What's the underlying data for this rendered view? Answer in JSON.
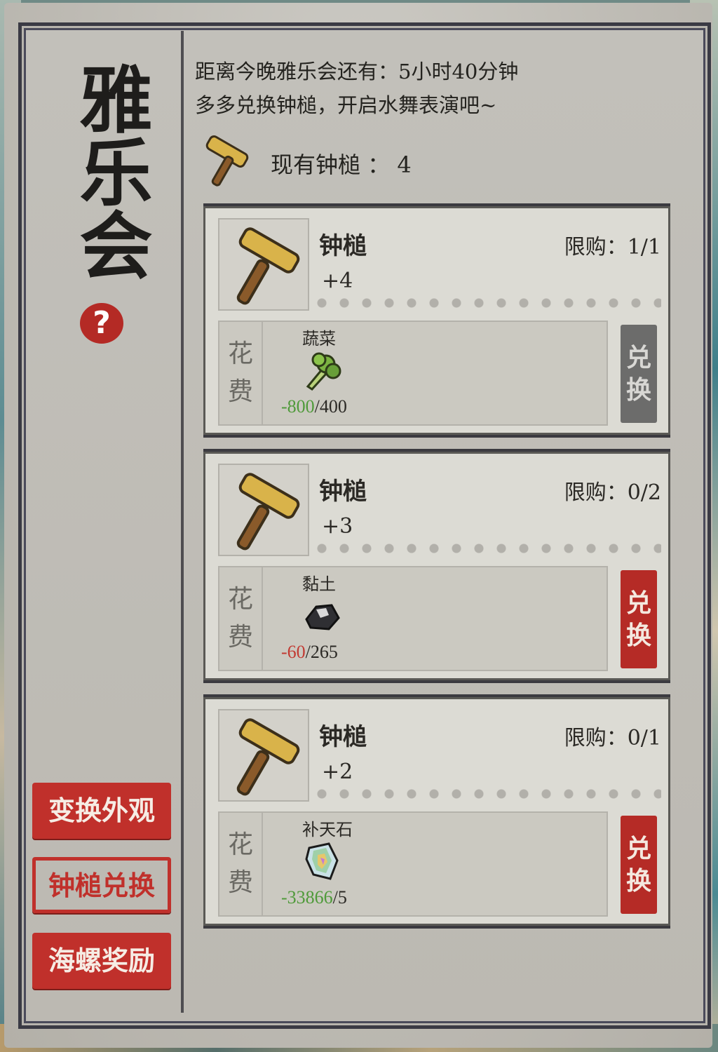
{
  "title": "雅乐会",
  "help_label": "?",
  "side_buttons": [
    {
      "label": "变换外观",
      "active": false
    },
    {
      "label": "钟槌兑换",
      "active": true
    },
    {
      "label": "海螺奖励",
      "active": false
    }
  ],
  "info": {
    "countdown": "距离今晚雅乐会还有：5小时40分钟",
    "tip": "多多兑换钟槌，开启水舞表演吧~"
  },
  "hammer_count": {
    "label": "现有钟槌 ：",
    "value": "4"
  },
  "cost_label": [
    "花",
    "费"
  ],
  "exchange_label": [
    "兑",
    "换"
  ],
  "items": [
    {
      "name": "钟槌",
      "plus": "+4",
      "limit": "限购：1/1",
      "resource": {
        "name": "蔬菜",
        "icon": "vegetable-icon",
        "cost": "-800",
        "cost_color": "#4f9a3a",
        "owned": "/400"
      },
      "exchange_enabled": false
    },
    {
      "name": "钟槌",
      "plus": "+3",
      "limit": "限购：0/2",
      "resource": {
        "name": "黏土",
        "icon": "clay-icon",
        "cost": "-60",
        "cost_color": "#c23b33",
        "owned": "/265"
      },
      "exchange_enabled": true
    },
    {
      "name": "钟槌",
      "plus": "+2",
      "limit": "限购：0/1",
      "resource": {
        "name": "补天石",
        "icon": "sky-stone-icon",
        "cost": "-33866",
        "cost_color": "#4f9a3a",
        "owned": "/5"
      },
      "exchange_enabled": true
    }
  ]
}
